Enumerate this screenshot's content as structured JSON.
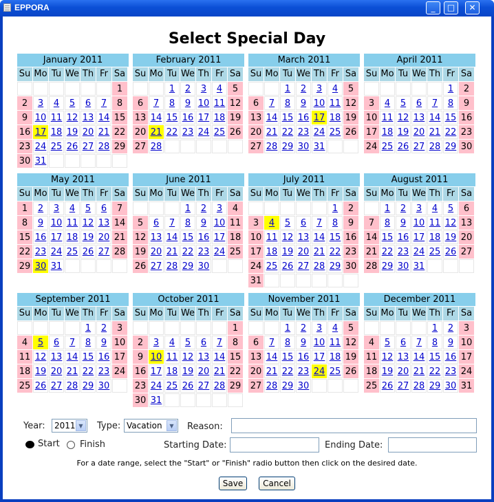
{
  "window": {
    "title": "EPPORA",
    "minimize": "_",
    "maximize": "□",
    "close": "✕"
  },
  "page_title": "Select Special Day",
  "dow_labels": [
    "Su",
    "Mo",
    "Tu",
    "We",
    "Th",
    "Fr",
    "Sa"
  ],
  "months": [
    {
      "title": "January 2011",
      "first_dow": 6,
      "days": 31,
      "highlight": [
        17
      ]
    },
    {
      "title": "February 2011",
      "first_dow": 2,
      "days": 28,
      "highlight": [
        21
      ]
    },
    {
      "title": "March 2011",
      "first_dow": 2,
      "days": 31,
      "highlight": [
        17
      ]
    },
    {
      "title": "April 2011",
      "first_dow": 5,
      "days": 30,
      "highlight": []
    },
    {
      "title": "May 2011",
      "first_dow": 0,
      "days": 31,
      "highlight": [
        30
      ]
    },
    {
      "title": "June 2011",
      "first_dow": 3,
      "days": 30,
      "highlight": []
    },
    {
      "title": "July 2011",
      "first_dow": 5,
      "days": 31,
      "highlight": [
        4
      ]
    },
    {
      "title": "August 2011",
      "first_dow": 1,
      "days": 31,
      "highlight": []
    },
    {
      "title": "September 2011",
      "first_dow": 4,
      "days": 30,
      "highlight": [
        5
      ]
    },
    {
      "title": "October 2011",
      "first_dow": 6,
      "days": 31,
      "highlight": [
        10
      ]
    },
    {
      "title": "November 2011",
      "first_dow": 2,
      "days": 30,
      "highlight": [
        24
      ]
    },
    {
      "title": "December 2011",
      "first_dow": 4,
      "days": 31,
      "highlight": []
    }
  ],
  "colors": {
    "month_header": "#87ceeb",
    "dow_header": "#add8e6",
    "weekend": "#ffc0cb",
    "special_day": "#ffff00",
    "link": "#0000cc"
  },
  "form": {
    "year_label": "Year:",
    "year_value": "2011",
    "type_label": "Type:",
    "type_value": "Vacation",
    "reason_label": "Reason:",
    "reason_value": "",
    "start_label": "Start",
    "finish_label": "Finish",
    "selected_radio": "start",
    "starting_date_label": "Starting Date:",
    "starting_date_value": "",
    "ending_date_label": "Ending Date:",
    "ending_date_value": "",
    "hint": "For a date range, select the \"Start\" or \"Finish\" radio button then click on the desired date.",
    "save_label": "Save",
    "cancel_label": "Cancel"
  }
}
